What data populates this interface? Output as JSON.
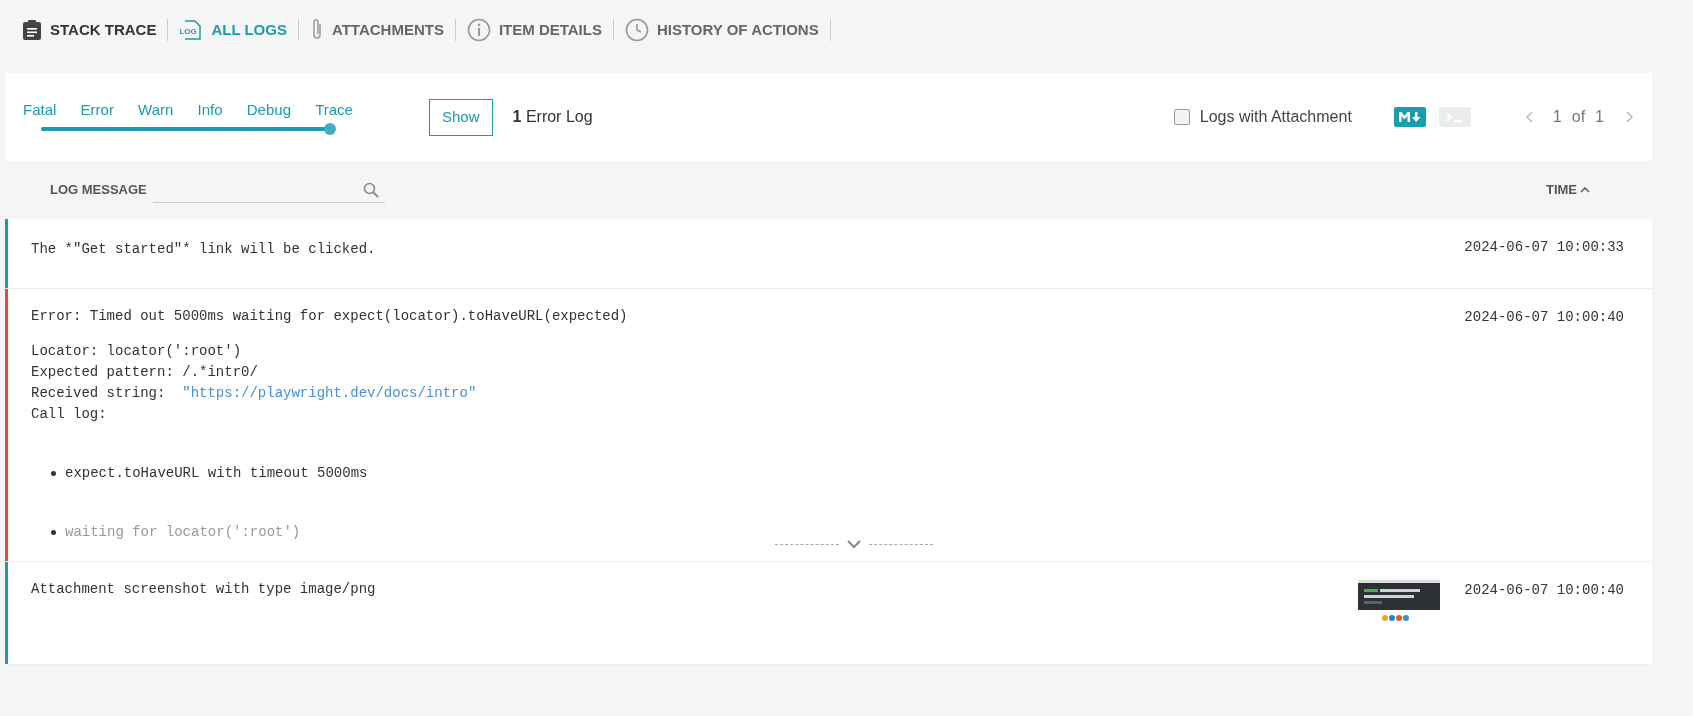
{
  "tabs": [
    {
      "label": "STACK TRACE",
      "selected": false
    },
    {
      "label": "ALL LOGS",
      "icon_text": "LOG",
      "selected": true
    },
    {
      "label": "ATTACHMENTS",
      "selected": false
    },
    {
      "label": "ITEM DETAILS",
      "selected": false
    },
    {
      "label": "HISTORY OF ACTIONS",
      "selected": false
    }
  ],
  "filter": {
    "levels": [
      "Fatal",
      "Error",
      "Warn",
      "Info",
      "Debug",
      "Trace"
    ],
    "level": 1,
    "show_button": "Show",
    "count": "1",
    "count_label": "Error Log",
    "attachment_checkbox": {
      "label": "Logs with Attachment",
      "checked": false
    },
    "view_toggles": [
      {
        "kind": "markdown",
        "selected": true
      },
      {
        "kind": "console",
        "selected": false
      }
    ],
    "pagination": {
      "current": "1",
      "of": "of",
      "total": "1"
    }
  },
  "table": {
    "columns": [
      {
        "label": "LOG MESSAGE"
      },
      {
        "label": "TIME"
      }
    ],
    "rows": [
      {
        "kind": "text",
        "color": "#1a9cb0",
        "message": "The *\"Get started\"* link will be clicked.",
        "time": "2024-06-07 10:00:33"
      },
      {
        "kind": "error",
        "color": "#f44336",
        "headline": "Error: Timed out 5000ms waiting for expect(locator).toHaveURL(expected)",
        "lines": [
          {
            "label": "Locator: locator(':root')"
          },
          {
            "label": "Expected pattern: /.*intr0/"
          },
          {
            "label": "Received string:  ",
            "link": "\"https://playwright.dev/docs/intro\""
          },
          {
            "label": "Call log:"
          }
        ],
        "bullets": [
          "expect.toHaveURL with timeout 5000ms",
          "waiting for locator(':root')"
        ],
        "time": "2024-06-07 10:00:40"
      },
      {
        "kind": "attachment",
        "color": "#1a9cb0",
        "message": "Attachment screenshot with type image/png",
        "time": "2024-06-07 10:00:40"
      }
    ]
  }
}
